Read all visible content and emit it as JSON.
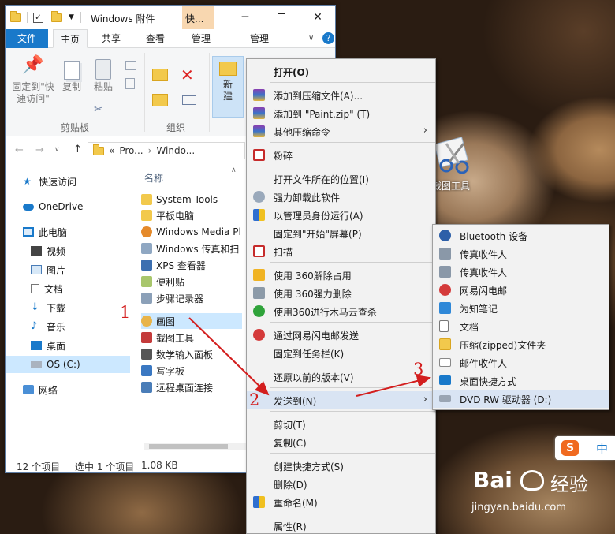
{
  "explorer": {
    "title": "Windows 附件",
    "context_tab": "快...",
    "tabs": {
      "file": "文件",
      "home": "主页",
      "share": "共享",
      "view": "查看",
      "manage1": "管理",
      "manage2": "管理"
    },
    "ribbon": {
      "pin_label_1": "固定到\"快",
      "pin_label_2": "速访问\"",
      "copy": "复制",
      "paste": "粘贴",
      "new_1": "新",
      "new_2": "建",
      "clipboard_group": "剪贴板",
      "organize_group": "组织"
    },
    "address": {
      "part1": "Pro...",
      "part2": "Windo...",
      "sep": "«"
    },
    "nav": [
      "快速访问",
      "OneDrive",
      "此电脑",
      "视频",
      "图片",
      "文档",
      "下载",
      "音乐",
      "桌面",
      "OS (C:)",
      "网络"
    ],
    "column_header": "名称",
    "files": [
      "System Tools",
      "平板电脑",
      "Windows Media Pl",
      "Windows 传真和扫",
      "XPS 查看器",
      "便利贴",
      "步骤记录器",
      "画图",
      "截图工具",
      "数学输入面板",
      "写字板",
      "远程桌面连接"
    ],
    "status": {
      "count": "12 个项目",
      "selected": "选中 1 个项目",
      "size": "1.08 KB"
    }
  },
  "context_menu": [
    "打开(O)",
    "添加到压缩文件(A)...",
    "添加到 \"Paint.zip\" (T)",
    "其他压缩命令",
    "粉碎",
    "打开文件所在的位置(I)",
    "强力卸载此软件",
    "以管理员身份运行(A)",
    "固定到\"开始\"屏幕(P)",
    "扫描",
    "使用 360解除占用",
    "使用 360强力删除",
    "使用360进行木马云查杀",
    "通过网易闪电邮发送",
    "固定到任务栏(K)",
    "还原以前的版本(V)",
    "发送到(N)",
    "剪切(T)",
    "复制(C)",
    "创建快捷方式(S)",
    "删除(D)",
    "重命名(M)",
    "属性(R)"
  ],
  "send_to_menu": [
    "Bluetooth 设备",
    "传真收件人",
    "传真收件人",
    "网易闪电邮",
    "为知笔记",
    "文档",
    "压缩(zipped)文件夹",
    "邮件收件人",
    "桌面快捷方式",
    "DVD RW 驱动器 (D:)"
  ],
  "desktop": {
    "icon_label": "截图工具"
  },
  "annotations": {
    "step1": "1",
    "step2": "2",
    "step3": "3",
    "arrow_color": "#d31e1e"
  },
  "ime": {
    "label": "中"
  },
  "watermark": {
    "brand": "Bai",
    "brand2": "经验",
    "url": "jingyan.baidu.com"
  },
  "colors": {
    "accent": "#1979ca",
    "selection": "#cce8ff",
    "menu_hover": "#d9e4f3"
  }
}
